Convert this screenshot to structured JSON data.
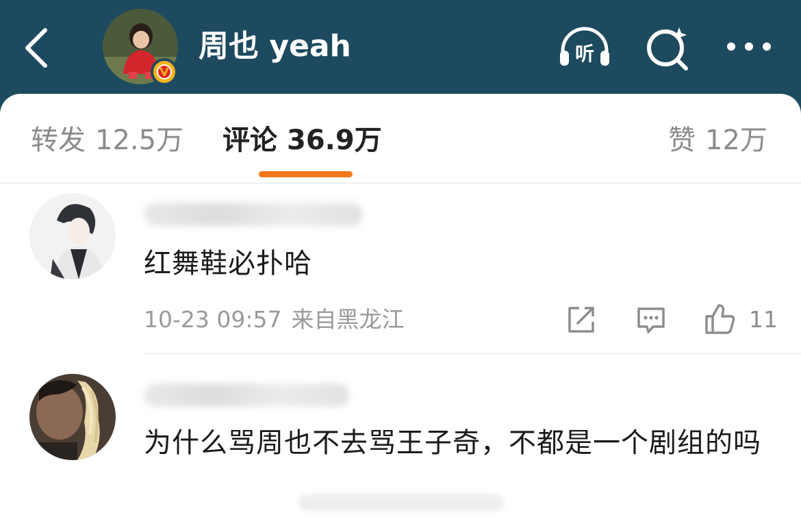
{
  "header": {
    "title": "周也 yeah",
    "listen_label": "听",
    "colors": {
      "background": "#1d4a5f",
      "badge": "#f6b31c"
    },
    "icons": [
      "back-arrow-icon",
      "listen-headphones-icon",
      "search-sparkle-icon",
      "more-dots-icon"
    ]
  },
  "tabs": [
    {
      "label": "转发",
      "count": "12.5万"
    },
    {
      "label": "评论",
      "count": "36.9万",
      "active": true
    },
    {
      "label": "赞",
      "count": "12万"
    }
  ],
  "accent_color": "#f3781c",
  "comments": [
    {
      "text": "红舞鞋必扑哈",
      "time": "10-23 09:57",
      "location": "来自黑龙江",
      "likes": "11"
    },
    {
      "text": "为什么骂周也不去骂王子奇，不都是一个剧组的吗"
    }
  ]
}
